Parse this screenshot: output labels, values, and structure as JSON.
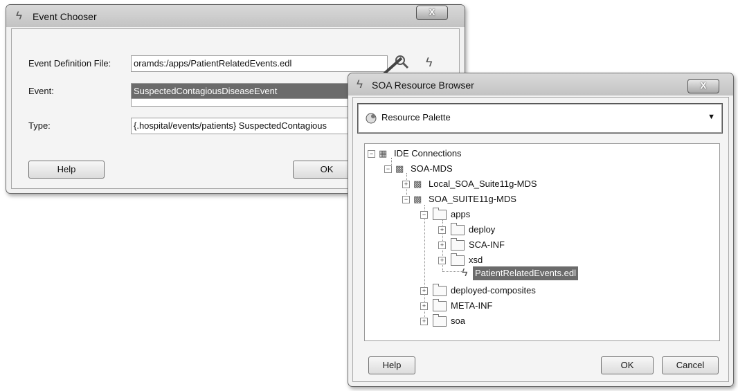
{
  "event_chooser": {
    "title": "Event Chooser",
    "close_label": "X",
    "definition_label": "Event Definition File:",
    "definition_value": "oramds:/apps/PatientRelatedEvents.edl",
    "event_label": "Event:",
    "event_value": "SuspectedContagiousDiseaseEvent",
    "type_label": "Type:",
    "type_value": "{.hospital/events/patients} SuspectedContagious",
    "help_label": "Help",
    "ok_label": "OK",
    "search_icon": "magnifier-icon",
    "event_icon": "lightning-icon"
  },
  "resource_browser": {
    "title": "SOA Resource Browser",
    "close_label": "X",
    "palette_selected": "Resource Palette",
    "help_label": "Help",
    "ok_label": "OK",
    "cancel_label": "Cancel",
    "tree": {
      "root": "IDE Connections",
      "soa_mds": "SOA-MDS",
      "local_conn": "Local_SOA_Suite11g-MDS",
      "suite_conn": "SOA_SUITE11g-MDS",
      "apps": "apps",
      "deploy": "deploy",
      "sca_inf": "SCA-INF",
      "xsd": "xsd",
      "edl_file": "PatientRelatedEvents.edl",
      "deployed_composites": "deployed-composites",
      "meta_inf": "META-INF",
      "soa": "soa"
    }
  },
  "colors": {
    "selection": "#6b6b6b",
    "window_bg": "#f1f1f1"
  }
}
